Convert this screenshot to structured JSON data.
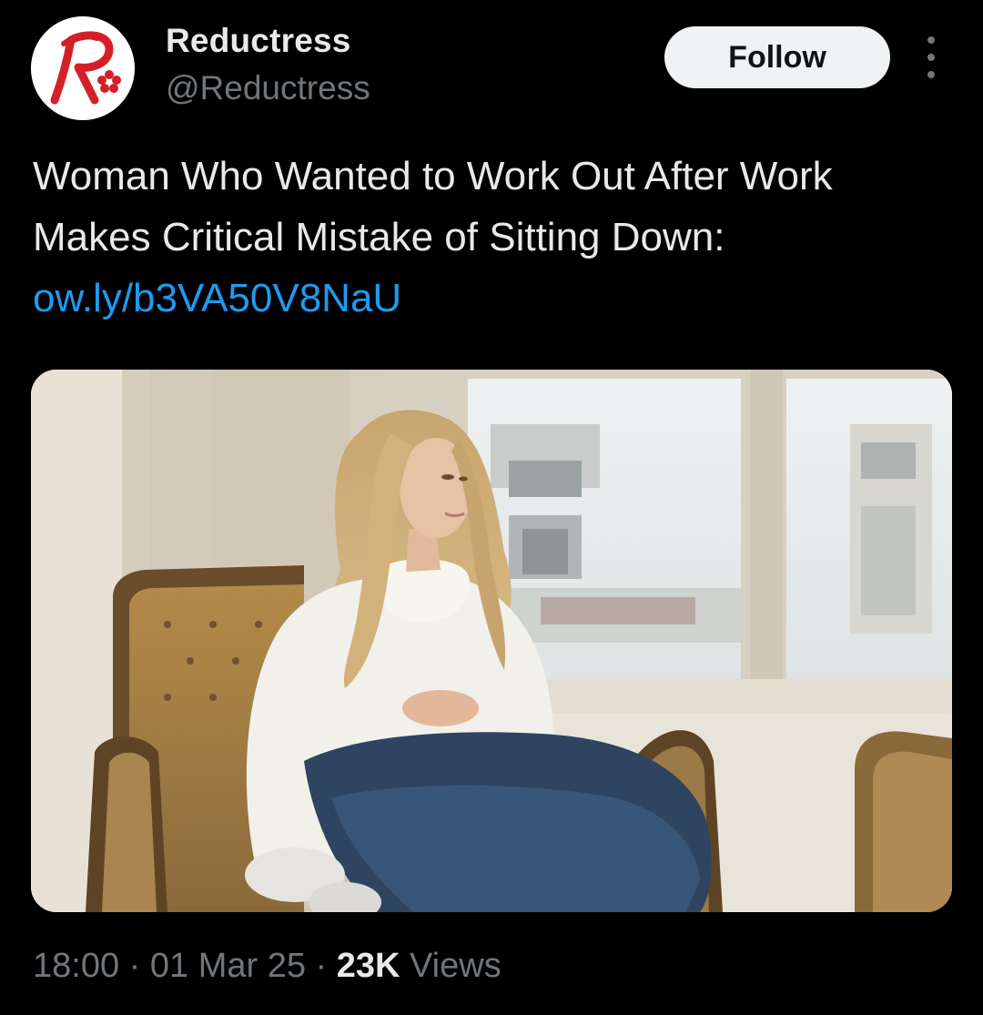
{
  "account": {
    "display_name": "Reductress",
    "handle": "@Reductress",
    "avatar_icon": "reductress-logo-icon",
    "avatar_letter": "R",
    "brand_color": "#d51f26"
  },
  "actions": {
    "follow_label": "Follow",
    "more_icon": "more-vertical-icon"
  },
  "tweet": {
    "text": "Woman Who Wanted to Work Out After Work Makes Critical Mistake of Sitting Down: ",
    "link_text": "ow.ly/b3VA50V8NaU",
    "link_color": "#1d9bf0"
  },
  "media": {
    "type": "photo"
  },
  "meta": {
    "time": "18:00",
    "separator": " · ",
    "date": "01 Mar 25",
    "views_count": "23K",
    "views_label": " Views"
  },
  "colors": {
    "background": "#000000",
    "primary_text": "#e7e9ea",
    "secondary_text": "#71767b",
    "follow_button_bg": "#eff3f4"
  }
}
